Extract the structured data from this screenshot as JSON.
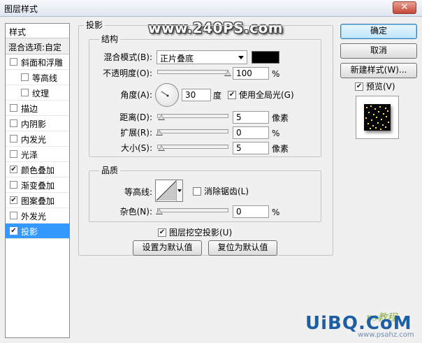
{
  "window": {
    "title": "图层样式",
    "close_label": "✕"
  },
  "watermark": "www.240PS.com",
  "left_panel": {
    "header": "样式",
    "blend_options": "混合选项:自定",
    "items": [
      {
        "label": "斜面和浮雕",
        "checked": false,
        "indent": false,
        "selected": false
      },
      {
        "label": "等高线",
        "checked": false,
        "indent": true,
        "selected": false
      },
      {
        "label": "纹理",
        "checked": false,
        "indent": true,
        "selected": false
      },
      {
        "label": "描边",
        "checked": false,
        "indent": false,
        "selected": false
      },
      {
        "label": "内阴影",
        "checked": false,
        "indent": false,
        "selected": false
      },
      {
        "label": "内发光",
        "checked": false,
        "indent": false,
        "selected": false
      },
      {
        "label": "光泽",
        "checked": false,
        "indent": false,
        "selected": false
      },
      {
        "label": "颜色叠加",
        "checked": true,
        "indent": false,
        "selected": false
      },
      {
        "label": "渐变叠加",
        "checked": false,
        "indent": false,
        "selected": false
      },
      {
        "label": "图案叠加",
        "checked": true,
        "indent": false,
        "selected": false
      },
      {
        "label": "外发光",
        "checked": false,
        "indent": false,
        "selected": false
      },
      {
        "label": "投影",
        "checked": true,
        "indent": false,
        "selected": true
      }
    ]
  },
  "drop_shadow": {
    "section_title": "投影",
    "structure": {
      "title": "结构",
      "blend_mode_label": "混合模式(B):",
      "blend_mode_value": "正片叠底",
      "shadow_color": "#000000",
      "opacity_label": "不透明度(O):",
      "opacity_value": "100",
      "opacity_unit": "%",
      "angle_label": "角度(A):",
      "angle_value": "30",
      "angle_unit": "度",
      "global_light_label": "使用全局光(G)",
      "global_light_checked": true,
      "distance_label": "距离(D):",
      "distance_value": "5",
      "distance_unit": "像素",
      "spread_label": "扩展(R):",
      "spread_value": "0",
      "spread_unit": "%",
      "size_label": "大小(S):",
      "size_value": "5",
      "size_unit": "像素"
    },
    "quality": {
      "title": "品质",
      "contour_label": "等高线:",
      "anti_alias_label": "消除锯齿(L)",
      "anti_alias_checked": false,
      "noise_label": "杂色(N):",
      "noise_value": "0",
      "noise_unit": "%"
    },
    "knockout_label": "图层挖空投影(U)",
    "knockout_checked": true,
    "make_default_label": "设置为默认值",
    "reset_default_label": "复位为默认值"
  },
  "buttons": {
    "ok": "确定",
    "cancel": "取消",
    "new_style": "新建样式(W)...",
    "preview_label": "预览(V)",
    "preview_checked": true
  },
  "branding": {
    "logo": "UiBQ.CoM",
    "url": "www.psahz.com",
    "small": "ps教程"
  }
}
